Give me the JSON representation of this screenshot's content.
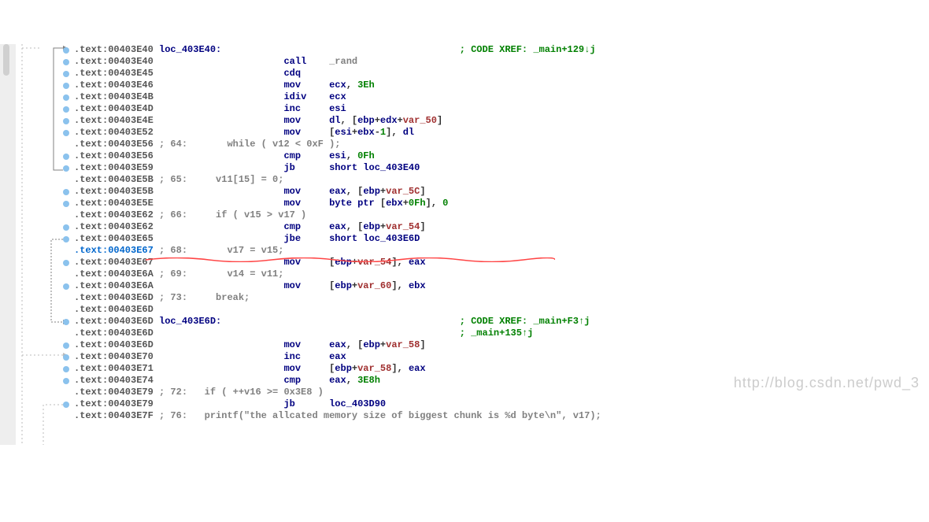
{
  "watermark": "http://blog.csdn.net/pwd_3",
  "lines": [
    {
      "addr": ".text:00403E40",
      "label": "loc_403E40:",
      "note_right": "; CODE XREF: _main+129↓j",
      "bp": true
    },
    {
      "addr": ".text:00403E40",
      "mnemonic": "call",
      "args": [
        {
          "t": "func",
          "v": "_rand"
        }
      ],
      "bp": true
    },
    {
      "addr": ".text:00403E45",
      "mnemonic": "cdq",
      "args": [],
      "bp": true
    },
    {
      "addr": ".text:00403E46",
      "mnemonic": "mov",
      "args": [
        {
          "t": "reg",
          "v": "ecx"
        },
        {
          "t": "plain",
          "v": ", "
        },
        {
          "t": "num",
          "v": "3Eh"
        }
      ],
      "bp": true
    },
    {
      "addr": ".text:00403E4B",
      "mnemonic": "idiv",
      "args": [
        {
          "t": "reg",
          "v": "ecx"
        }
      ],
      "bp": true
    },
    {
      "addr": ".text:00403E4D",
      "mnemonic": "inc",
      "args": [
        {
          "t": "reg",
          "v": "esi"
        }
      ],
      "bp": true
    },
    {
      "addr": ".text:00403E4E",
      "mnemonic": "mov",
      "args": [
        {
          "t": "reg",
          "v": "dl"
        },
        {
          "t": "plain",
          "v": ", ["
        },
        {
          "t": "reg",
          "v": "ebp"
        },
        {
          "t": "plain",
          "v": "+"
        },
        {
          "t": "reg",
          "v": "edx"
        },
        {
          "t": "plain",
          "v": "+"
        },
        {
          "t": "var",
          "v": "var_50"
        },
        {
          "t": "plain",
          "v": "]"
        }
      ],
      "bp": true
    },
    {
      "addr": ".text:00403E52",
      "mnemonic": "mov",
      "args": [
        {
          "t": "plain",
          "v": "["
        },
        {
          "t": "reg",
          "v": "esi"
        },
        {
          "t": "plain",
          "v": "+"
        },
        {
          "t": "reg",
          "v": "ebx"
        },
        {
          "t": "plain",
          "v": "-"
        },
        {
          "t": "num",
          "v": "1"
        },
        {
          "t": "plain",
          "v": "], "
        },
        {
          "t": "reg",
          "v": "dl"
        }
      ],
      "bp": true
    },
    {
      "addr": ".text:00403E56",
      "comment_line": "; 64:       while ( v12 < 0xF );"
    },
    {
      "addr": ".text:00403E56",
      "mnemonic": "cmp",
      "args": [
        {
          "t": "reg",
          "v": "esi"
        },
        {
          "t": "plain",
          "v": ", "
        },
        {
          "t": "num",
          "v": "0Fh"
        }
      ],
      "bp": true
    },
    {
      "addr": ".text:00403E59",
      "mnemonic": "jb",
      "args": [
        {
          "t": "label",
          "v": "short loc_403E40"
        }
      ],
      "bp": true
    },
    {
      "addr": ".text:00403E5B",
      "comment_line": "; 65:     v11[15] = 0;"
    },
    {
      "addr": ".text:00403E5B",
      "mnemonic": "mov",
      "args": [
        {
          "t": "reg",
          "v": "eax"
        },
        {
          "t": "plain",
          "v": ", ["
        },
        {
          "t": "reg",
          "v": "ebp"
        },
        {
          "t": "plain",
          "v": "+"
        },
        {
          "t": "var",
          "v": "var_5C"
        },
        {
          "t": "plain",
          "v": "]"
        }
      ],
      "bp": true
    },
    {
      "addr": ".text:00403E5E",
      "mnemonic": "mov",
      "args": [
        {
          "t": "reg",
          "v": "byte ptr"
        },
        {
          "t": "plain",
          "v": " ["
        },
        {
          "t": "reg",
          "v": "ebx"
        },
        {
          "t": "plain",
          "v": "+"
        },
        {
          "t": "num",
          "v": "0Fh"
        },
        {
          "t": "plain",
          "v": "], "
        },
        {
          "t": "num",
          "v": "0"
        }
      ],
      "bp": true
    },
    {
      "addr": ".text:00403E62",
      "comment_line": "; 66:     if ( v15 > v17 )"
    },
    {
      "addr": ".text:00403E62",
      "mnemonic": "cmp",
      "args": [
        {
          "t": "reg",
          "v": "eax"
        },
        {
          "t": "plain",
          "v": ", ["
        },
        {
          "t": "reg",
          "v": "ebp"
        },
        {
          "t": "plain",
          "v": "+"
        },
        {
          "t": "var",
          "v": "var_54"
        },
        {
          "t": "plain",
          "v": "]"
        }
      ],
      "bp": true
    },
    {
      "addr": ".text:00403E65",
      "mnemonic": "jbe",
      "args": [
        {
          "t": "label",
          "v": "short loc_403E6D"
        }
      ],
      "bp": true
    },
    {
      "addr_hl": ".text:00403E67",
      "comment_line_hl": "; 68:       v17 = v15;"
    },
    {
      "addr": ".text:00403E67",
      "mnemonic": "mov",
      "args": [
        {
          "t": "plain",
          "v": "["
        },
        {
          "t": "reg",
          "v": "ebp"
        },
        {
          "t": "plain",
          "v": "+"
        },
        {
          "t": "var",
          "v": "var_54"
        },
        {
          "t": "plain",
          "v": "], "
        },
        {
          "t": "reg",
          "v": "eax"
        }
      ],
      "bp": true
    },
    {
      "addr": ".text:00403E6A",
      "comment_line": "; 69:       v14 = v11;"
    },
    {
      "addr": ".text:00403E6A",
      "mnemonic": "mov",
      "args": [
        {
          "t": "plain",
          "v": "["
        },
        {
          "t": "reg",
          "v": "ebp"
        },
        {
          "t": "plain",
          "v": "+"
        },
        {
          "t": "var",
          "v": "var_60"
        },
        {
          "t": "plain",
          "v": "], "
        },
        {
          "t": "reg",
          "v": "ebx"
        }
      ],
      "bp": true
    },
    {
      "addr": ".text:00403E6D",
      "comment_line": "; 73:     break;"
    },
    {
      "addr": ".text:00403E6D",
      "blank": true
    },
    {
      "addr": ".text:00403E6D",
      "label": "loc_403E6D:",
      "note_right": "; CODE XREF: _main+F3↑j",
      "bp": true
    },
    {
      "addr": ".text:00403E6D",
      "note_right_only": "; _main+135↑j"
    },
    {
      "addr": ".text:00403E6D",
      "mnemonic": "mov",
      "args": [
        {
          "t": "reg",
          "v": "eax"
        },
        {
          "t": "plain",
          "v": ", ["
        },
        {
          "t": "reg",
          "v": "ebp"
        },
        {
          "t": "plain",
          "v": "+"
        },
        {
          "t": "var",
          "v": "var_58"
        },
        {
          "t": "plain",
          "v": "]"
        }
      ],
      "bp": true
    },
    {
      "addr": ".text:00403E70",
      "mnemonic": "inc",
      "args": [
        {
          "t": "reg",
          "v": "eax"
        }
      ],
      "bp": true
    },
    {
      "addr": ".text:00403E71",
      "mnemonic": "mov",
      "args": [
        {
          "t": "plain",
          "v": "["
        },
        {
          "t": "reg",
          "v": "ebp"
        },
        {
          "t": "plain",
          "v": "+"
        },
        {
          "t": "var",
          "v": "var_58"
        },
        {
          "t": "plain",
          "v": "], "
        },
        {
          "t": "reg",
          "v": "eax"
        }
      ],
      "bp": true
    },
    {
      "addr": ".text:00403E74",
      "mnemonic": "cmp",
      "args": [
        {
          "t": "reg",
          "v": "eax"
        },
        {
          "t": "plain",
          "v": ", "
        },
        {
          "t": "num",
          "v": "3E8h"
        }
      ],
      "bp": true
    },
    {
      "addr": ".text:00403E79",
      "comment_line": "; 72:   if ( ++v16 >= 0x3E8 )"
    },
    {
      "addr": ".text:00403E79",
      "mnemonic": "jb",
      "args": [
        {
          "t": "label",
          "v": "loc_403D90"
        }
      ],
      "bp": true
    },
    {
      "addr": ".text:00403E7F",
      "comment_line": "; 76:   printf(\"the allcated memory size of biggest chunk is %d byte\\n\", v17);"
    }
  ]
}
